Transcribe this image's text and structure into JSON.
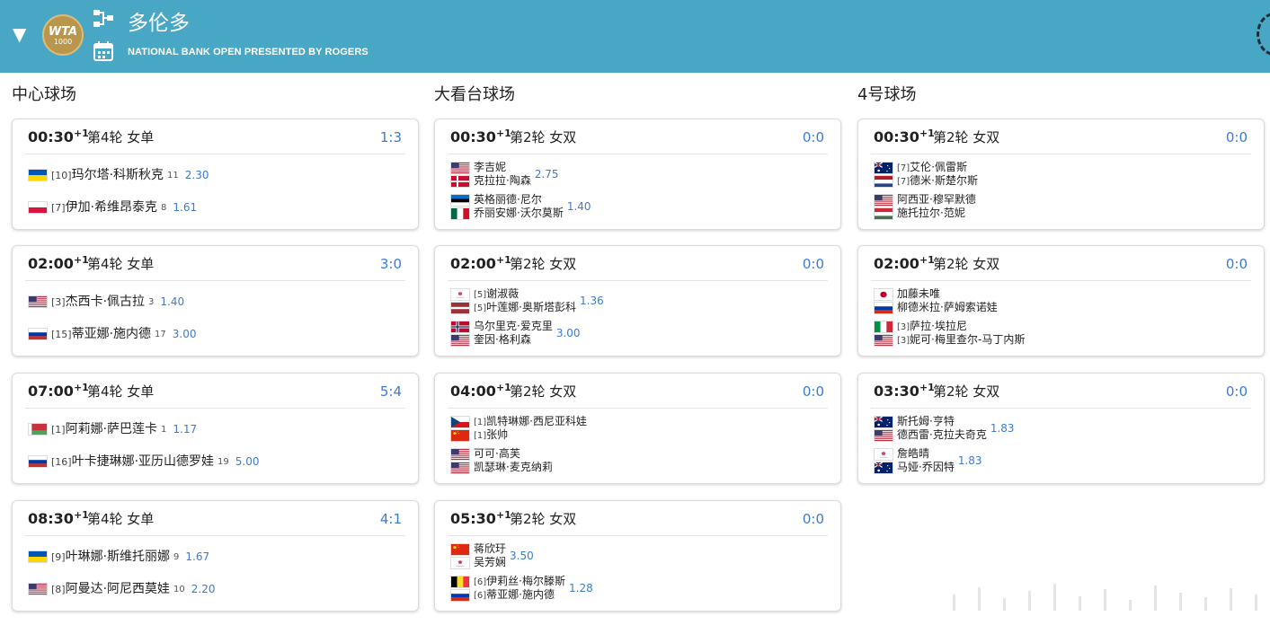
{
  "header": {
    "title": "多伦多",
    "subtitle": "NATIONAL BANK OPEN PRESENTED BY ROGERS",
    "logo_line1": "WTA",
    "logo_line2": "1000",
    "collapse_icon": "▼"
  },
  "colors": {
    "header_bg": "#48a7c4",
    "accent_blue": "#3a7bd5",
    "logo_gold": "#b9964b"
  },
  "courts": [
    {
      "name": "中心球场",
      "matches": [
        {
          "time": "00:30",
          "day": "+1",
          "round": "第4轮 女单",
          "score": "1:3",
          "players": [
            {
              "flag": "UA",
              "seed": "[10]",
              "name": "玛尔塔·科斯秋克",
              "rank": "11",
              "odds": "2.30"
            },
            {
              "flag": "PL",
              "seed": "[7]",
              "name": "伊加·希维昂泰克",
              "rank": "8",
              "odds": "1.61"
            }
          ]
        },
        {
          "time": "02:00",
          "day": "+1",
          "round": "第4轮 女单",
          "score": "3:0",
          "players": [
            {
              "flag": "US",
              "seed": "[3]",
              "name": "杰西卡·佩古拉",
              "rank": "3",
              "odds": "1.40"
            },
            {
              "flag": "RU",
              "seed": "[15]",
              "name": "蒂亚娜·施内德",
              "rank": "17",
              "odds": "3.00"
            }
          ]
        },
        {
          "time": "07:00",
          "day": "+1",
          "round": "第4轮 女单",
          "score": "5:4",
          "players": [
            {
              "flag": "BY",
              "seed": "[1]",
              "name": "阿莉娜·萨巴莲卡",
              "rank": "1",
              "odds": "1.17"
            },
            {
              "flag": "RU",
              "seed": "[16]",
              "name": "叶卡捷琳娜·亚历山德罗娃",
              "rank": "19",
              "odds": "5.00"
            }
          ]
        },
        {
          "time": "08:30",
          "day": "+1",
          "round": "第4轮 女单",
          "score": "4:1",
          "players": [
            {
              "flag": "UA",
              "seed": "[9]",
              "name": "叶琳娜·斯维托丽娜",
              "rank": "9",
              "odds": "1.67"
            },
            {
              "flag": "US",
              "seed": "[8]",
              "name": "阿曼达·阿尼西莫娃",
              "rank": "10",
              "odds": "2.20"
            }
          ]
        }
      ]
    },
    {
      "name": "大看台球场",
      "matches": [
        {
          "time": "00:30",
          "day": "+1",
          "round": "第2轮 女双",
          "score": "0:0",
          "teams": [
            {
              "odds": "2.75",
              "players": [
                {
                  "flag": "US",
                  "seed": "",
                  "name": "李吉妮"
                },
                {
                  "flag": "DK",
                  "seed": "",
                  "name": "克拉拉·陶森"
                }
              ]
            },
            {
              "odds": "1.40",
              "players": [
                {
                  "flag": "EE",
                  "seed": "",
                  "name": "英格丽德·尼尔"
                },
                {
                  "flag": "MX",
                  "seed": "",
                  "name": "乔丽安娜·沃尔莫斯"
                }
              ]
            }
          ]
        },
        {
          "time": "02:00",
          "day": "+1",
          "round": "第2轮 女双",
          "score": "0:0",
          "teams": [
            {
              "odds": "1.36",
              "players": [
                {
                  "flag": "TW",
                  "seed": "[5]",
                  "name": "谢淑薇"
                },
                {
                  "flag": "LV",
                  "seed": "[5]",
                  "name": "叶莲娜·奥斯塔彭科"
                }
              ]
            },
            {
              "odds": "3.00",
              "players": [
                {
                  "flag": "NO",
                  "seed": "",
                  "name": "乌尔里克·爱克里"
                },
                {
                  "flag": "US",
                  "seed": "",
                  "name": "奎因·格利森"
                }
              ]
            }
          ]
        },
        {
          "time": "04:00",
          "day": "+1",
          "round": "第2轮 女双",
          "score": "0:0",
          "teams": [
            {
              "odds": "",
              "players": [
                {
                  "flag": "CZ",
                  "seed": "[1]",
                  "name": "凯特琳娜·西尼亚科娃"
                },
                {
                  "flag": "CN",
                  "seed": "[1]",
                  "name": "张帅"
                }
              ]
            },
            {
              "odds": "",
              "players": [
                {
                  "flag": "US",
                  "seed": "",
                  "name": "可可·高芙"
                },
                {
                  "flag": "US",
                  "seed": "",
                  "name": "凯瑟琳·麦克纳莉"
                }
              ]
            }
          ]
        },
        {
          "time": "05:30",
          "day": "+1",
          "round": "第2轮 女双",
          "score": "0:0",
          "teams": [
            {
              "odds": "3.50",
              "players": [
                {
                  "flag": "CN",
                  "seed": "",
                  "name": "蒋欣玗"
                },
                {
                  "flag": "TW",
                  "seed": "",
                  "name": "吴芳娴"
                }
              ]
            },
            {
              "odds": "1.28",
              "players": [
                {
                  "flag": "BE",
                  "seed": "[6]",
                  "name": "伊莉丝·梅尔滕斯"
                },
                {
                  "flag": "RU",
                  "seed": "[6]",
                  "name": "蒂亚娜·施内德"
                }
              ]
            }
          ]
        }
      ]
    },
    {
      "name": "4号球场",
      "matches": [
        {
          "time": "00:30",
          "day": "+1",
          "round": "第2轮 女双",
          "score": "0:0",
          "teams": [
            {
              "odds": "",
              "players": [
                {
                  "flag": "AU",
                  "seed": "[7]",
                  "name": "艾伦·佩雷斯"
                },
                {
                  "flag": "NL",
                  "seed": "[7]",
                  "name": "德米·斯楚尔斯"
                }
              ]
            },
            {
              "odds": "",
              "players": [
                {
                  "flag": "US",
                  "seed": "",
                  "name": "阿西亚·穆罕默德"
                },
                {
                  "flag": "HU",
                  "seed": "",
                  "name": "施托拉尔·范妮"
                }
              ]
            }
          ]
        },
        {
          "time": "02:00",
          "day": "+1",
          "round": "第2轮 女双",
          "score": "0:0",
          "teams": [
            {
              "odds": "",
              "players": [
                {
                  "flag": "JP",
                  "seed": "",
                  "name": "加藤未唯"
                },
                {
                  "flag": "RU",
                  "seed": "",
                  "name": "柳德米拉·萨姆索诺娃"
                }
              ]
            },
            {
              "odds": "",
              "players": [
                {
                  "flag": "IT",
                  "seed": "[3]",
                  "name": "萨拉·埃拉尼"
                },
                {
                  "flag": "US",
                  "seed": "[3]",
                  "name": "妮可·梅里查尔-马丁内斯"
                }
              ]
            }
          ]
        },
        {
          "time": "03:30",
          "day": "+1",
          "round": "第2轮 女双",
          "score": "0:0",
          "teams": [
            {
              "odds": "1.83",
              "players": [
                {
                  "flag": "AU",
                  "seed": "",
                  "name": "斯托姆·亨特"
                },
                {
                  "flag": "US",
                  "seed": "",
                  "name": "德西雷·克拉夫奇克"
                }
              ]
            },
            {
              "odds": "1.83",
              "players": [
                {
                  "flag": "TW",
                  "seed": "",
                  "name": "詹皓晴"
                },
                {
                  "flag": "AU",
                  "seed": "",
                  "name": "马娅·乔因特"
                }
              ]
            }
          ]
        }
      ]
    }
  ]
}
